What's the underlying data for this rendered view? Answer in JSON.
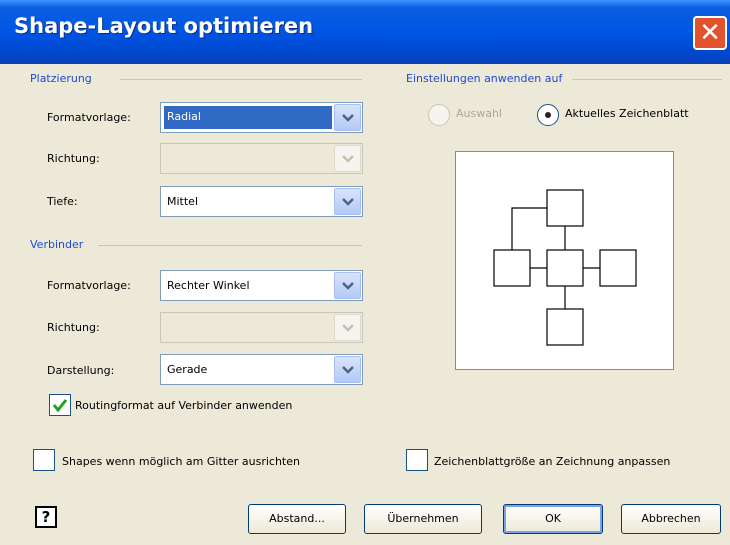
{
  "dialog": {
    "title": "Shape-Layout optimieren"
  },
  "placement": {
    "group_label": "Platzierung",
    "style_label": "Formatvorlage:",
    "style_value": "Radial",
    "direction_label": "Richtung:",
    "direction_value": "",
    "depth_label": "Tiefe:",
    "depth_value": "Mittel"
  },
  "connector": {
    "group_label": "Verbinder",
    "style_label": "Formatvorlage:",
    "style_value": "Rechter Winkel",
    "direction_label": "Richtung:",
    "direction_value": "",
    "appearance_label": "Darstellung:",
    "appearance_value": "Gerade",
    "routing_label": "Routingformat auf Verbinder anwenden",
    "routing_checked": true
  },
  "apply_to": {
    "group_label": "Einstellungen anwenden auf",
    "selection_label": "Auswahl",
    "current_page_label": "Aktuelles Zeichenblatt",
    "selected": "current_page"
  },
  "options": {
    "align_grid_label": "Shapes wenn möglich am Gitter ausrichten",
    "align_grid_checked": false,
    "resize_page_label": "Zeichenblattgröße an Zeichnung anpassen",
    "resize_page_checked": false
  },
  "buttons": {
    "help": "?",
    "spacing": "Abstand...",
    "apply": "Übernehmen",
    "ok": "OK",
    "cancel": "Abbrechen"
  },
  "colors": {
    "titlebar": "#0055e5",
    "group_label": "#1f4bd0",
    "selection": "#316ac5",
    "dialog_bg": "#ece9d8"
  }
}
